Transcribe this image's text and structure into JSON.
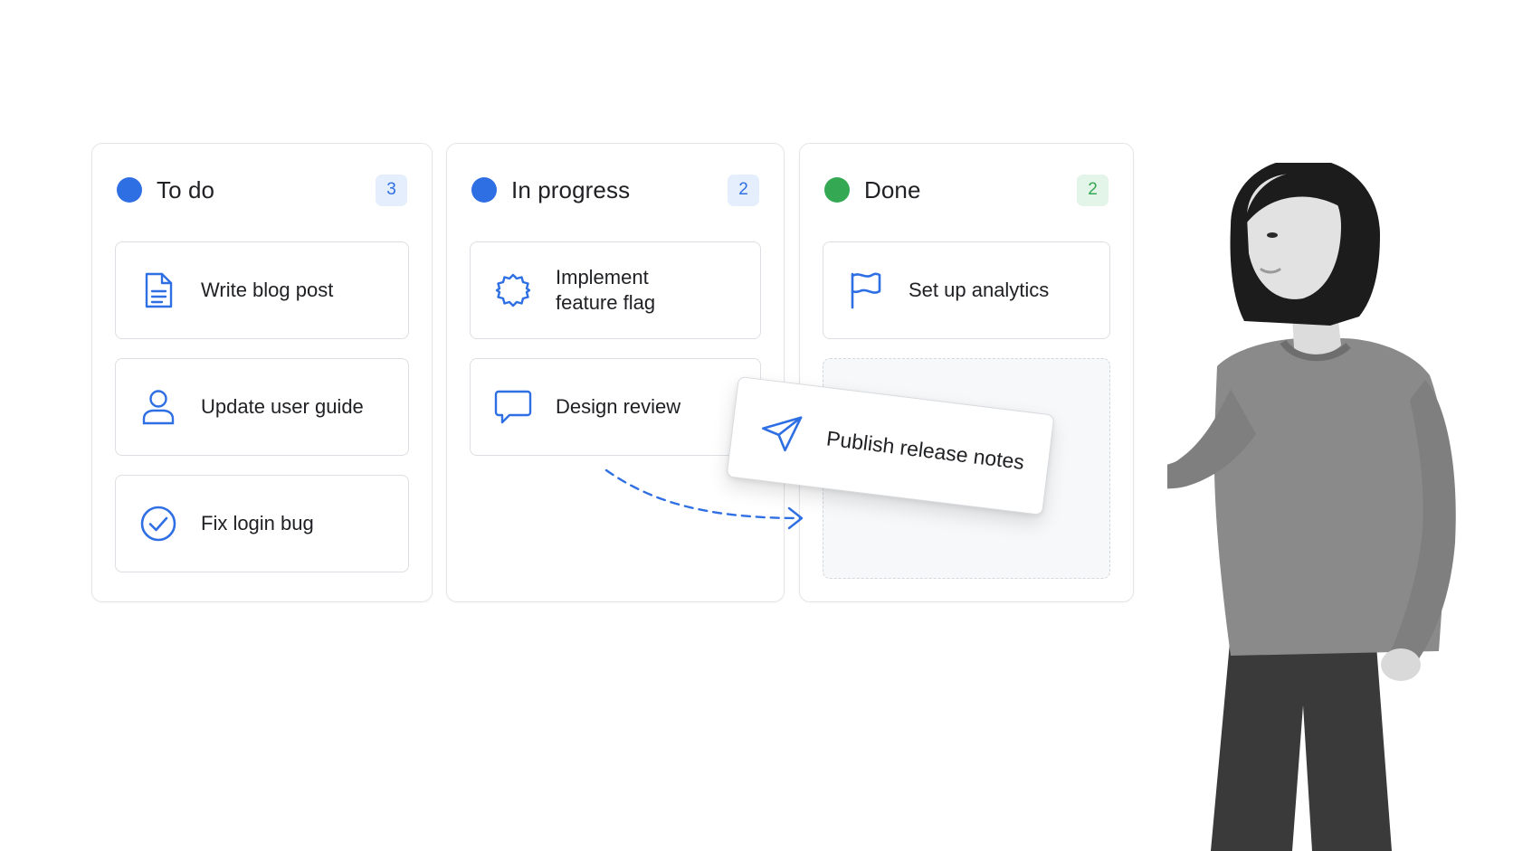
{
  "colors": {
    "accent_blue": "#2f6fe4",
    "done_green": "#34a853",
    "badge_blue_bg": "#e4eefc",
    "badge_blue_text": "#2f6fe4",
    "badge_green_bg": "#e3f4e8",
    "badge_green_text": "#34a853"
  },
  "columns": [
    {
      "title": "To do",
      "count": "3",
      "cards": [
        {
          "label": "Write blog post",
          "icon": "document-icon"
        },
        {
          "label": "Update user guide",
          "icon": "user-icon"
        },
        {
          "label": "Fix login bug",
          "icon": "check-circle-icon"
        }
      ]
    },
    {
      "title": "In progress",
      "count": "2",
      "cards": [
        {
          "label": "Implement\nfeature flag",
          "icon": "gear-icon"
        },
        {
          "label": "Design review",
          "icon": "chat-bubble-icon"
        }
      ]
    },
    {
      "title": "Done",
      "count": "2",
      "cards": [
        {
          "label": "Set up analytics",
          "icon": "flag-icon"
        }
      ]
    }
  ],
  "dragging_card": {
    "label": "Publish release notes",
    "icon": "send-icon"
  }
}
